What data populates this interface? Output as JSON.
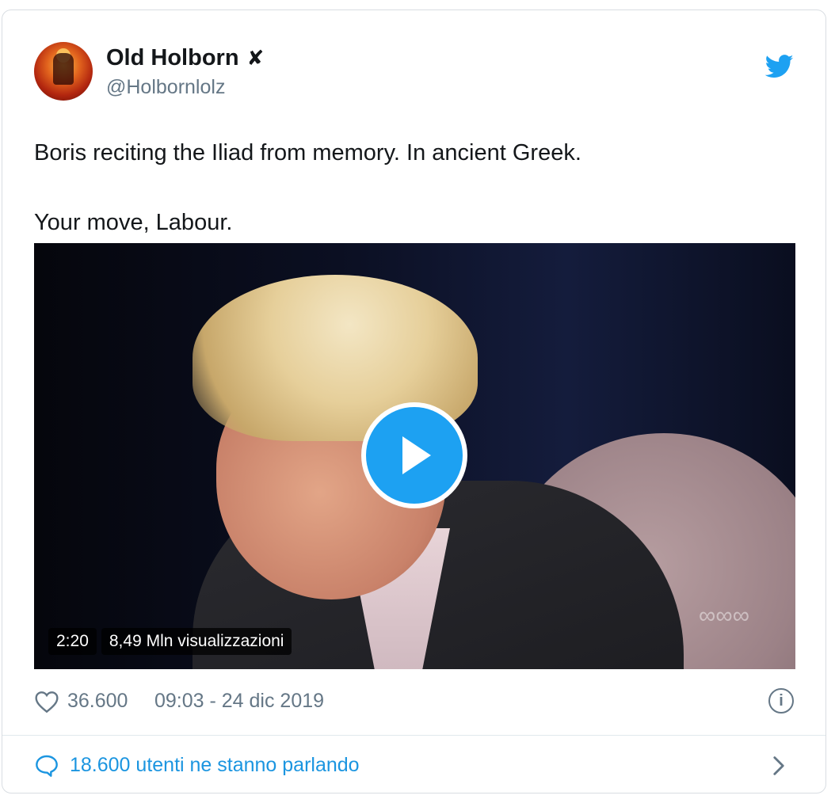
{
  "author": {
    "name": "Old Holborn",
    "badge": "✘",
    "handle": "@Holbornlolz"
  },
  "tweet": {
    "lines": [
      "Boris reciting the Iliad from memory. In ancient Greek.",
      "Your move, Labour."
    ]
  },
  "video": {
    "duration": "2:20",
    "views": "8,49 Mln visualizzazioni",
    "watermark": "∞∞∞"
  },
  "meta": {
    "likes": "36.600",
    "timestamp": "09:03 - 24 dic 2019",
    "info_glyph": "i"
  },
  "footer": {
    "conversation": "18.600 utenti ne stanno parlando"
  },
  "colors": {
    "accent": "#1da1f2",
    "link": "#1b95e0",
    "muted": "#657786"
  },
  "icons": [
    "twitter-bird-icon",
    "play-icon",
    "heart-icon",
    "info-icon",
    "speech-bubble-icon",
    "chevron-right-icon"
  ]
}
